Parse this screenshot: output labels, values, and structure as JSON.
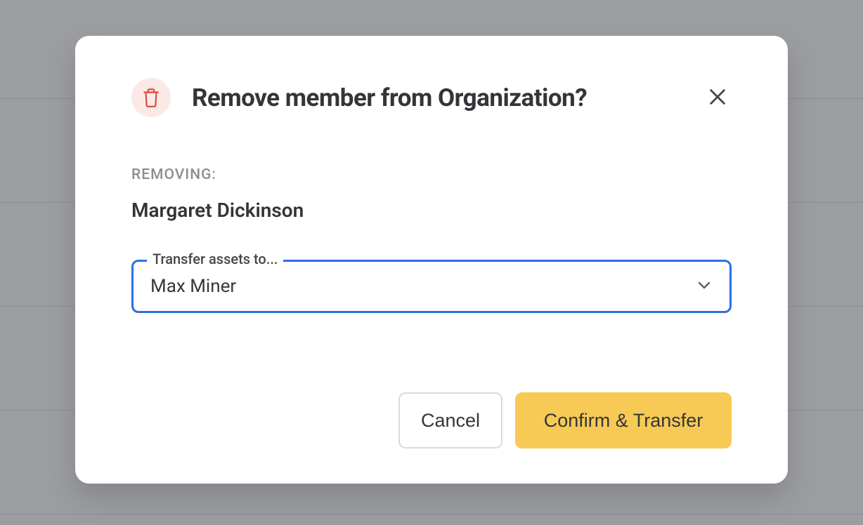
{
  "modal": {
    "title": "Remove member from Organization?",
    "removing_label": "REMOVING:",
    "removing_name": "Margaret Dickinson",
    "transfer": {
      "legend": "Transfer assets to...",
      "selected": "Max Miner"
    },
    "actions": {
      "cancel": "Cancel",
      "confirm": "Confirm & Transfer"
    }
  },
  "colors": {
    "accent_blue": "#2e6ee6",
    "primary_yellow": "#f7ca55",
    "danger_bg": "#fbe9e6",
    "danger_icon": "#d84b3a"
  }
}
